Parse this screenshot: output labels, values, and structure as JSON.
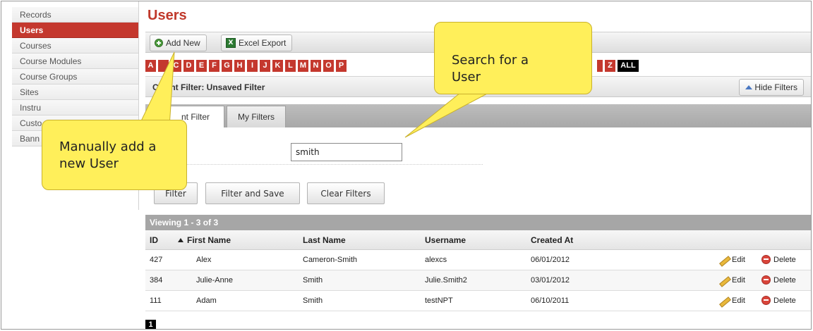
{
  "sidebar": {
    "items": [
      "Records",
      "Users",
      "Courses",
      "Course Modules",
      "Course Groups",
      "Sites",
      "Instru",
      "Custo",
      "Bann"
    ],
    "active_index": 1
  },
  "page": {
    "title": "Users"
  },
  "toolbar": {
    "add_new": "Add New",
    "excel_export": "Excel Export",
    "excel_icon_glyph": "X"
  },
  "alphabet": {
    "letters": [
      "A",
      "",
      "C",
      "D",
      "E",
      "F",
      "G",
      "H",
      "I",
      "J",
      "K",
      "L",
      "M",
      "N",
      "O",
      "P"
    ],
    "tail_letters": [
      "Z"
    ],
    "all_label": "ALL"
  },
  "filters": {
    "current_filter_label": "C     nt Filter: Unsaved Filter",
    "hide_filters": "Hide Filters",
    "tabs": [
      "nt Filter",
      "My Filters"
    ],
    "search_value": "smith",
    "buttons": {
      "filter": "Filter",
      "filter_and_save": "Filter and Save",
      "clear_filters": "Clear Filters"
    }
  },
  "table": {
    "viewing": "Viewing 1 - 3 of 3",
    "columns": [
      "ID",
      "First Name",
      "Last Name",
      "Username",
      "Created At"
    ],
    "rows": [
      {
        "id": "427",
        "first": "Alex",
        "last": "Cameron-Smith",
        "username": "alexcs",
        "created": "06/01/2012"
      },
      {
        "id": "384",
        "first": "Julie-Anne",
        "last": "Smith",
        "username": "Julie.Smith2",
        "created": "03/01/2012"
      },
      {
        "id": "111",
        "first": "Adam",
        "last": "Smith",
        "username": "testNPT",
        "created": "06/10/2011"
      }
    ],
    "edit_label": "Edit",
    "delete_label": "Delete"
  },
  "pagination": {
    "current": "1"
  },
  "callouts": {
    "add": "Manually add a new User",
    "search": "Search for a User"
  },
  "colors": {
    "accent": "#c4382e",
    "callout": "#ffef5a"
  }
}
